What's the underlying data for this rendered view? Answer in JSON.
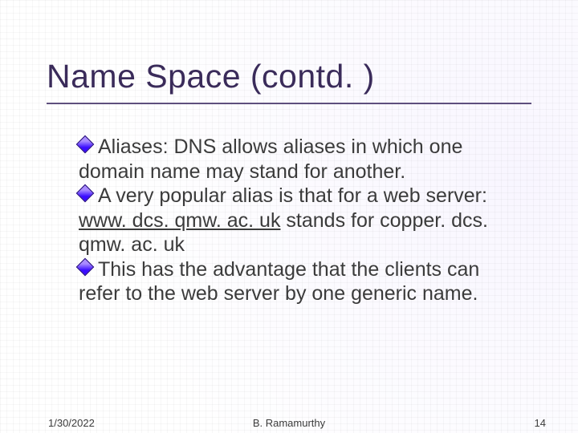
{
  "title": "Name Space (contd. )",
  "bullets": [
    {
      "prefix": "Aliases: ",
      "rest": "DNS allows aliases in which one domain name may stand for another."
    },
    {
      "prefix": "A very popular alias is that for a web server: ",
      "link": "www. dcs. qmw. ac. uk",
      "rest": " stands for copper. dcs. qmw. ac. uk"
    },
    {
      "prefix": "This has the advantage that the clients can refer to the web server by one generic name.",
      "rest": ""
    }
  ],
  "footer": {
    "date": "1/30/2022",
    "author": "B. Ramamurthy",
    "page": "14"
  }
}
